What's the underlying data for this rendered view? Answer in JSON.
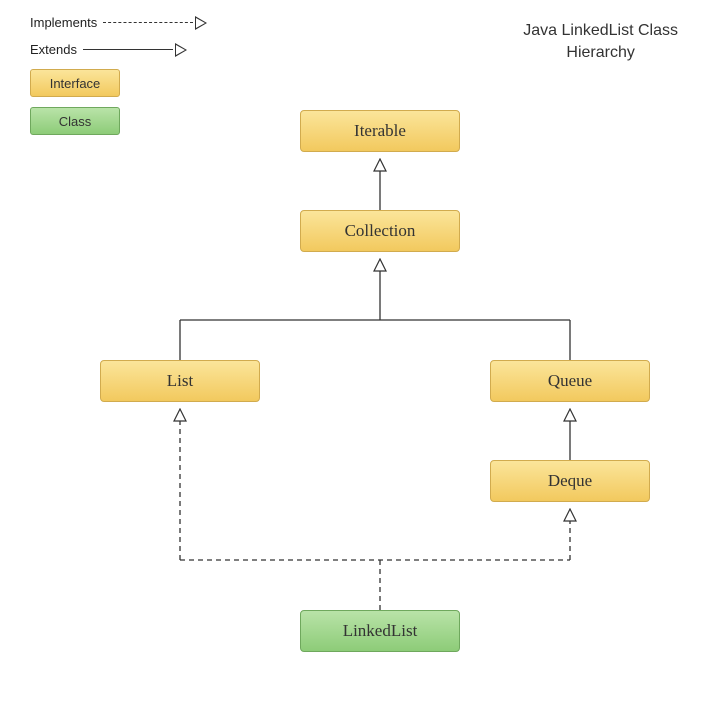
{
  "title_line1": "Java LinkedList Class",
  "title_line2": "Hierarchy",
  "legend": {
    "implements": "Implements",
    "extends": "Extends",
    "interface": "Interface",
    "class": "Class"
  },
  "nodes": {
    "iterable": "Iterable",
    "collection": "Collection",
    "list": "List",
    "queue": "Queue",
    "deque": "Deque",
    "linkedlist": "LinkedList"
  },
  "relationships": [
    {
      "from": "Collection",
      "to": "Iterable",
      "type": "extends"
    },
    {
      "from": "List",
      "to": "Collection",
      "type": "extends"
    },
    {
      "from": "Queue",
      "to": "Collection",
      "type": "extends"
    },
    {
      "from": "Deque",
      "to": "Queue",
      "type": "extends"
    },
    {
      "from": "LinkedList",
      "to": "List",
      "type": "implements"
    },
    {
      "from": "LinkedList",
      "to": "Deque",
      "type": "implements"
    }
  ]
}
